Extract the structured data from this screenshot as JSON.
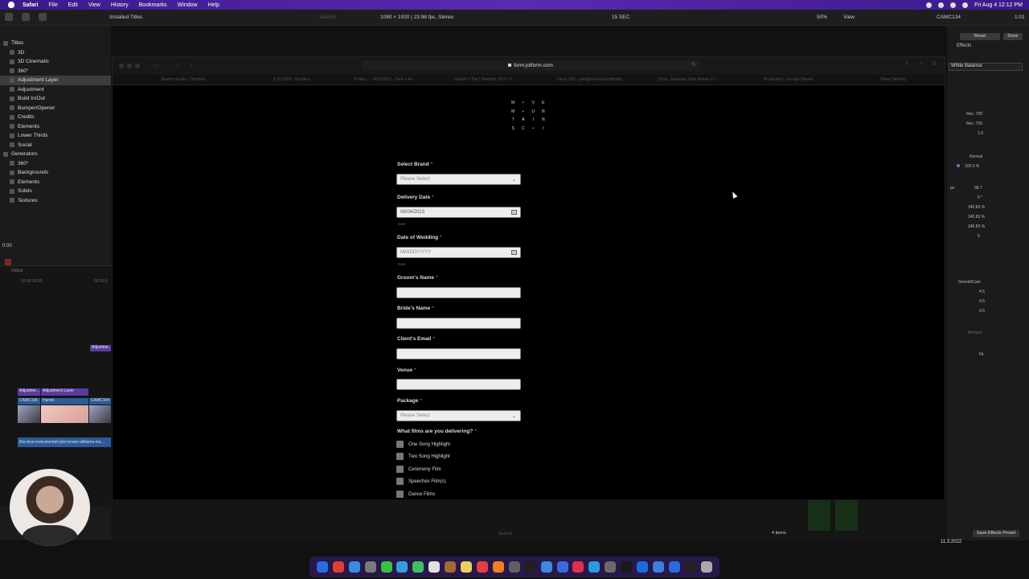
{
  "menubar": {
    "app": "Safari",
    "items": [
      "File",
      "Edit",
      "View",
      "History",
      "Bookmarks",
      "Window",
      "Help"
    ],
    "clock": "Fri Aug 4  12:12 PM"
  },
  "fcp_toolbar": {
    "installed_titles": "Installed Titles",
    "format": "1080 × 1920 | 23.98 fps, Stereo",
    "duration": "15 SEC",
    "zoom": "50%",
    "view": "View",
    "clip_name": "CAMC134",
    "time": "1:01",
    "reset": "Reset",
    "done": "Done",
    "effects": "Effects",
    "search_placeholder": "Search"
  },
  "library": [
    {
      "label": "Titles",
      "level": 0
    },
    {
      "label": "3D",
      "level": 1
    },
    {
      "label": "3D Cinematic",
      "level": 1
    },
    {
      "label": "360°",
      "level": 1
    },
    {
      "label": "Adjustment Layer",
      "level": 1,
      "selected": true
    },
    {
      "label": "Adjustment",
      "level": 1
    },
    {
      "label": "Build In/Out",
      "level": 1
    },
    {
      "label": "Bumper/Opener",
      "level": 1
    },
    {
      "label": "Credits",
      "level": 1
    },
    {
      "label": "Elements",
      "level": 1
    },
    {
      "label": "Lower Thirds",
      "level": 1
    },
    {
      "label": "Social",
      "level": 1
    },
    {
      "label": "Generators",
      "level": 0
    },
    {
      "label": "360°",
      "level": 1
    },
    {
      "label": "Backgrounds",
      "level": 1
    },
    {
      "label": "Elements",
      "level": 1
    },
    {
      "label": "Solids",
      "level": 1
    },
    {
      "label": "Textures",
      "level": 1
    }
  ],
  "timecode_left": "0:00",
  "timeline": {
    "index": "Index",
    "tc1": "00:00:00:00",
    "tc2": "00:00:0",
    "adj_small": "Adjustme...",
    "adj_track_a": "Adjustme...",
    "adj_track_b": "Adjustment Layer",
    "clip1": "CAMC136",
    "clip2": "Hands",
    "clip3": "CAMC154",
    "audio": "this-love-instrumental-tyler-brown-williams-mu..."
  },
  "inspector": {
    "title": "White Balance",
    "rec1": "Rec. 709",
    "rec2": "Rec. 709",
    "v1": "1.0",
    "blend": "Normal",
    "opacity": "100.0 %",
    "pos_x": "38.7",
    "unit_px": "px",
    "rot": "0 °",
    "s1": "340.83 %",
    "s2": "345.83 %",
    "s3": "340.83 %",
    "pos_y": "0",
    "smoothcam": "SmoothCam",
    "sc1": "4.5",
    "sc2": "4.5",
    "sc3": "4.5",
    "medium": "Medium",
    "fit": "Fit"
  },
  "bottom": {
    "items": "4 items",
    "search_placeholder": "Search",
    "save_preset": "Save Effects Preset",
    "version": "11.3.2022"
  },
  "safari": {
    "url": "form.jotform.com",
    "tabs": [
      "Search results - Dropbox",
      "8.15.2018 - Dropbox",
      "Produc... - 8/23/2023 - Zach + Ar...",
      "Garrett + The | Hewport, Ri m V/...",
      "Inbox (10) - julia@movemountainsfil...",
      "(Ortiz, Jessenia) Zack Arlene V1 -...",
      "Production - Google Sheets",
      "Video Delivery"
    ]
  },
  "logo_letters": [
    "M",
    "•",
    "V",
    "E",
    "M",
    "•",
    "U",
    "N",
    "T",
    "A",
    "I",
    "N",
    "S",
    "C",
    "•",
    "/"
  ],
  "form": {
    "brand_label": "Select Brand",
    "brand_placeholder": "Please Select",
    "delivery_label": "Delivery Date",
    "delivery_value": "08/04/2023",
    "delivery_sub": "Date",
    "wedding_label": "Date of Wedding",
    "wedding_placeholder": "MM/DD/YYYY",
    "wedding_sub": "Date",
    "groom_label": "Groom's Name",
    "bride_label": "Bride's Name",
    "email_label": "Client's Email",
    "venue_label": "Venue",
    "package_label": "Package",
    "package_placeholder": "Please Select",
    "films_label": "What films are you delivering?",
    "films": [
      "One Song Highlight",
      "Two Song Highlight",
      "Ceremony Film",
      "Speeches Film(s)",
      "Dance Films"
    ],
    "required_mark": "*"
  },
  "dock_colors": [
    "#2a6de0",
    "#e04030",
    "#3a8ae0",
    "#7a7a7a",
    "#3ac040",
    "#3a9ae0",
    "#40c060",
    "#e0e0e0",
    "#a06a30",
    "#e8d060",
    "#e04040",
    "#f08020",
    "#606060",
    "#202020",
    "#3a8ae0",
    "#3a6ae0",
    "#e03050",
    "#2a9ae0",
    "#6a6a6a",
    "#1a1a1a",
    "#1a6ae0",
    "#3a80e0",
    "#2a6ae0",
    "#222",
    "#aaa"
  ]
}
